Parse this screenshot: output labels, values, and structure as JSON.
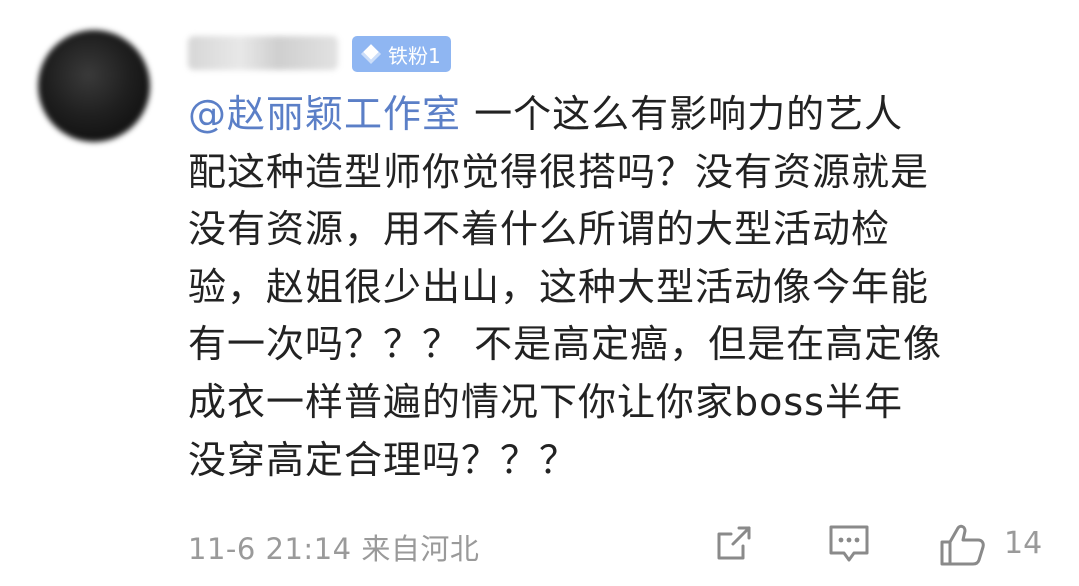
{
  "post": {
    "badge_label": "铁粉1",
    "mention": "@赵丽颖工作室",
    "body_lines": [
      " 一个这么有影响力的艺人",
      "配这种造型师你觉得很搭吗？没有资源就是",
      "没有资源，用不着什么所谓的大型活动检",
      "验，赵姐很少出山，这种大型活动像今年能",
      "有一次吗？？？ 不是高定癌，但是在高定像",
      "成衣一样普遍的情况下你让你家boss半年",
      "没穿高定合理吗？？？"
    ],
    "timestamp": "11-6 21:14",
    "source": "来自河北",
    "like_count": "14"
  },
  "colors": {
    "mention": "#5b7fc7",
    "badge_bg": "#8fb6f2",
    "text": "#222222",
    "meta": "#9a9a9a"
  },
  "icons": [
    "diamond-icon",
    "share-icon",
    "comment-icon",
    "thumbs-up-icon"
  ]
}
